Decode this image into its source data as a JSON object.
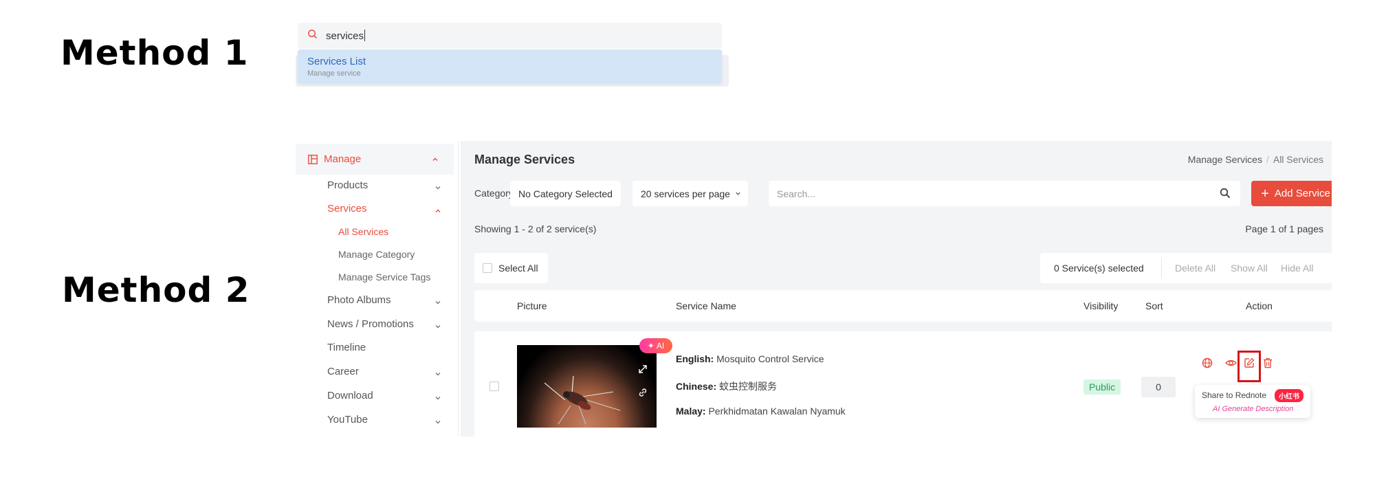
{
  "labels": {
    "method1": "Method 1",
    "method2": "Method 2"
  },
  "quick_search": {
    "query": "services",
    "result_title": "Services List",
    "result_subtitle": "Manage service"
  },
  "sidebar": {
    "section": "Manage",
    "items": [
      {
        "label": "Products",
        "expandable": true
      },
      {
        "label": "Services",
        "expandable": true,
        "active": true
      },
      {
        "label": "Photo Albums",
        "expandable": true
      },
      {
        "label": "News / Promotions",
        "expandable": true
      },
      {
        "label": "Timeline",
        "expandable": false
      },
      {
        "label": "Career",
        "expandable": true
      },
      {
        "label": "Download",
        "expandable": true
      },
      {
        "label": "YouTube",
        "expandable": true
      }
    ],
    "services_sub": [
      "All Services",
      "Manage Category",
      "Manage Service Tags"
    ]
  },
  "header": {
    "title": "Manage Services",
    "breadcrumb": [
      "Manage Services",
      "All Services"
    ]
  },
  "filters": {
    "category_label": "Category:",
    "category_value": "No Category Selected",
    "per_page": "20 services per page",
    "search_placeholder": "Search...",
    "add_label": "Add Service"
  },
  "summary": {
    "showing": "Showing 1 - 2 of 2 service(s)",
    "pages": "Page 1 of 1 pages"
  },
  "bulk": {
    "select_all": "Select All",
    "selected": "0 Service(s) selected",
    "delete_all": "Delete All",
    "show_all": "Show All",
    "hide_all": "Hide All"
  },
  "table": {
    "columns": [
      "Picture",
      "Service Name",
      "Visibility",
      "Sort",
      "Action"
    ],
    "rows": [
      {
        "ai_badge": "AI",
        "names": [
          {
            "lang": "English:",
            "value": "Mosquito Control Service"
          },
          {
            "lang": "Chinese:",
            "value": "蚊虫控制服务"
          },
          {
            "lang": "Malay:",
            "value": "Perkhidmatan Kawalan Nyamuk"
          }
        ],
        "visibility": "Public",
        "sort": "0"
      }
    ]
  },
  "tooltip": {
    "share": "Share to Rednote",
    "brand": "小红书",
    "ai_desc": "AI Generate Description"
  },
  "colors": {
    "accent": "#e74c3c",
    "highlight": "#d4141b",
    "public_bg": "#d6f5e3",
    "dropdown": "#d3e5f7"
  }
}
